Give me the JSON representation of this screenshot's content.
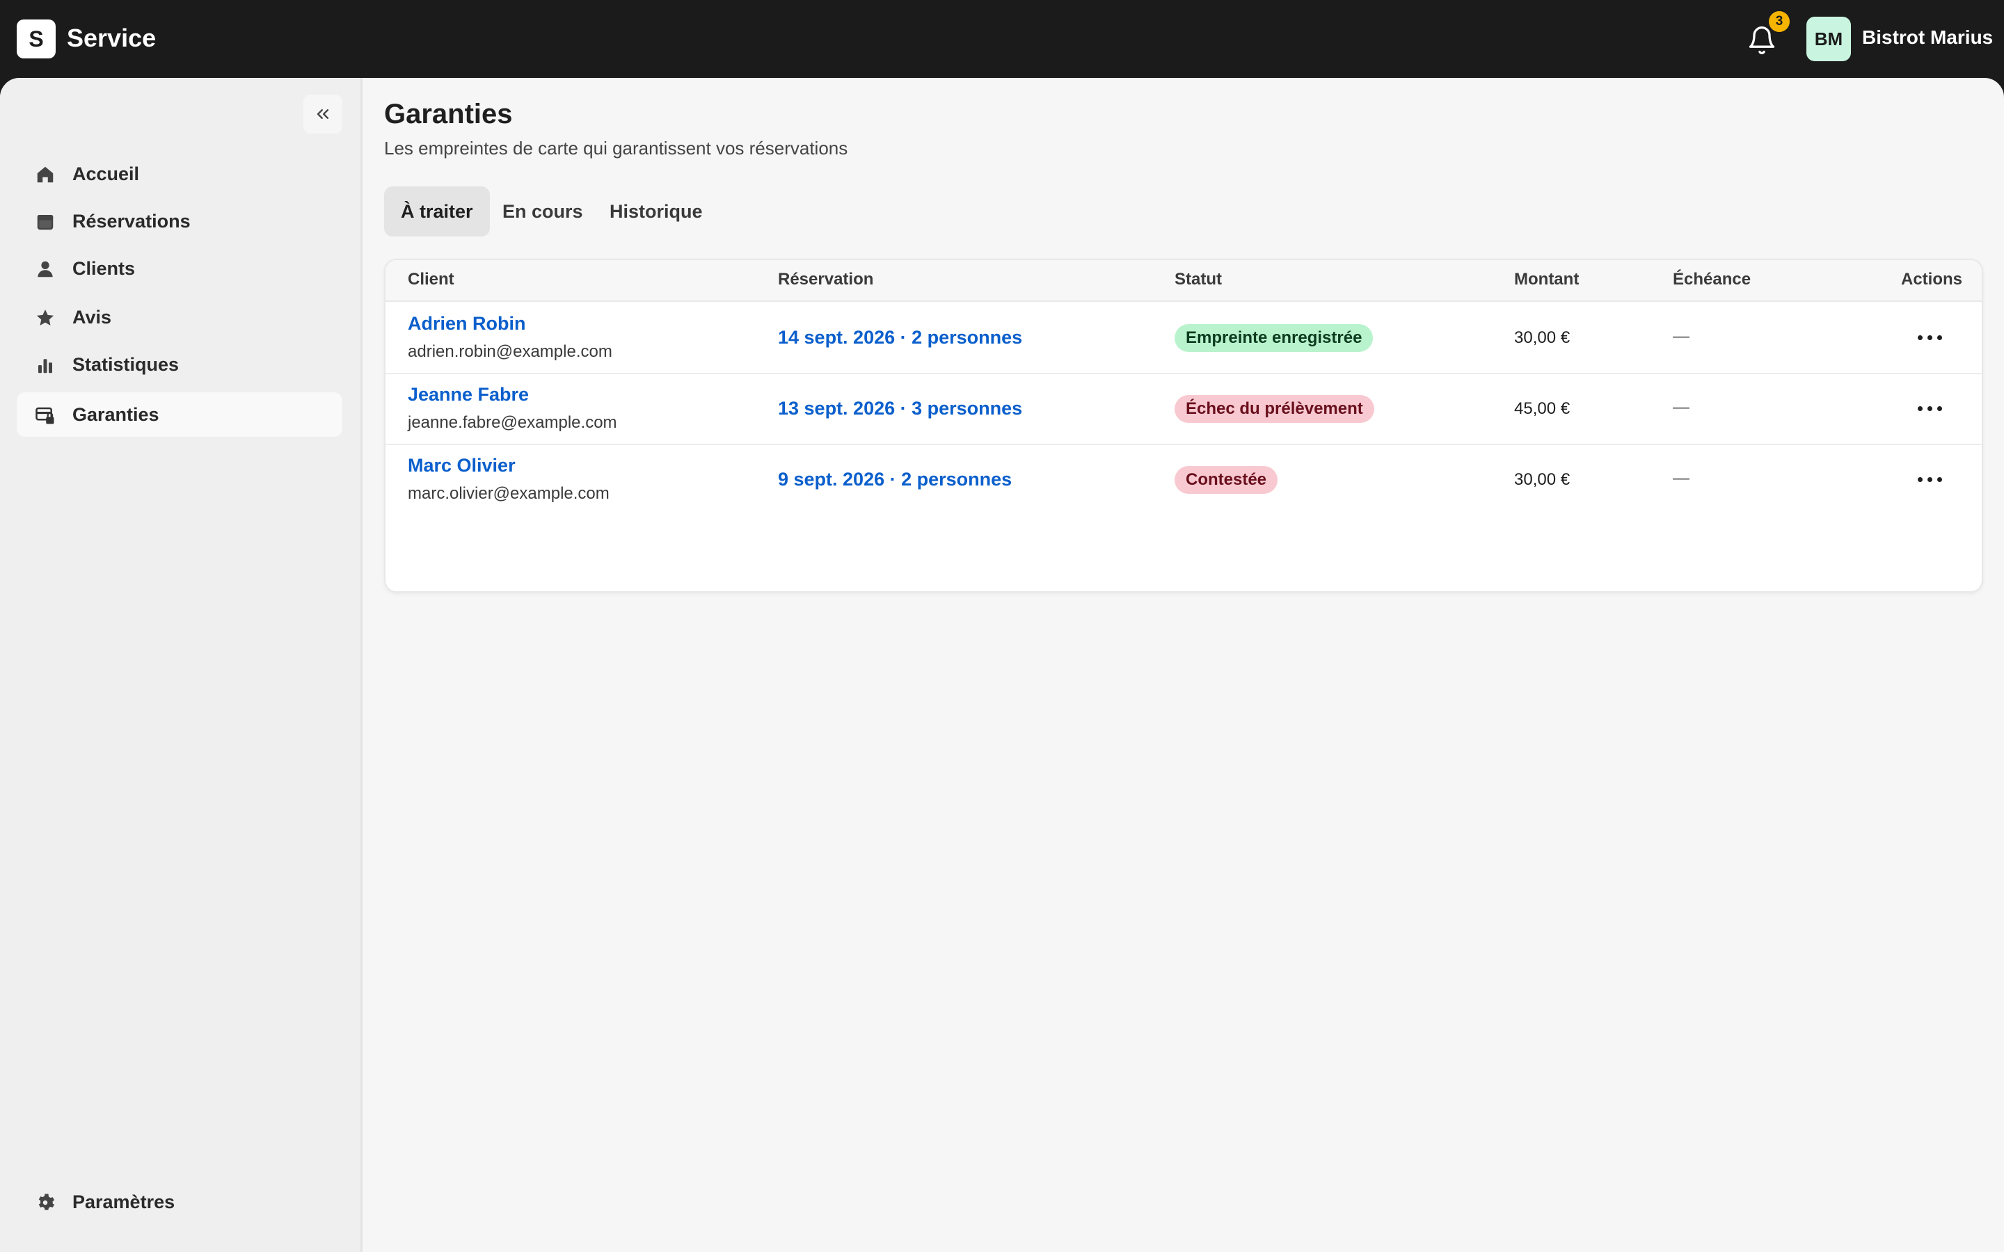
{
  "app": {
    "logo_letter": "S",
    "name": "Service"
  },
  "header": {
    "notification_count": "3",
    "avatar_initials": "BM",
    "account_name": "Bistrot Marius"
  },
  "sidebar": {
    "items": [
      {
        "label": "Accueil",
        "icon": "home-icon"
      },
      {
        "label": "Réservations",
        "icon": "calendar-icon"
      },
      {
        "label": "Clients",
        "icon": "person-icon"
      },
      {
        "label": "Avis",
        "icon": "star-icon"
      },
      {
        "label": "Statistiques",
        "icon": "bar-chart-icon"
      },
      {
        "label": "Garanties",
        "icon": "card-lock-icon",
        "active": true
      }
    ],
    "footer_item": {
      "label": "Paramètres",
      "icon": "gear-icon"
    }
  },
  "page": {
    "title": "Garanties",
    "subtitle": "Les empreintes de carte qui garantissent vos réservations"
  },
  "tabs": [
    {
      "label": "À traiter",
      "active": true
    },
    {
      "label": "En cours",
      "active": false
    },
    {
      "label": "Historique",
      "active": false
    }
  ],
  "table": {
    "columns": [
      "Client",
      "Réservation",
      "Statut",
      "Montant",
      "Échéance",
      "Actions"
    ],
    "rows": [
      {
        "name": "Adrien Robin",
        "email": "adrien.robin@example.com",
        "reservation": "14 sept. 2026 · 2 personnes",
        "status": "Empreinte enregistrée",
        "status_tone": "success",
        "amount": "30,00 €",
        "due": "—"
      },
      {
        "name": "Jeanne Fabre",
        "email": "jeanne.fabre@example.com",
        "reservation": "13 sept. 2026 · 3 personnes",
        "status": "Échec du prélèvement",
        "status_tone": "danger",
        "amount": "45,00 €",
        "due": "—"
      },
      {
        "name": "Marc Olivier",
        "email": "marc.olivier@example.com",
        "reservation": "9 sept. 2026 · 2 personnes",
        "status": "Contestée",
        "status_tone": "danger",
        "amount": "30,00 €",
        "due": "—"
      }
    ]
  },
  "colors": {
    "topbar": "#1b1b1b",
    "link": "#0b5fcc",
    "success_badge": "#b9f3cd",
    "danger_badge": "#f8c9d0",
    "notification_badge": "#f5b400",
    "avatar_bg": "#c9f5e0"
  }
}
